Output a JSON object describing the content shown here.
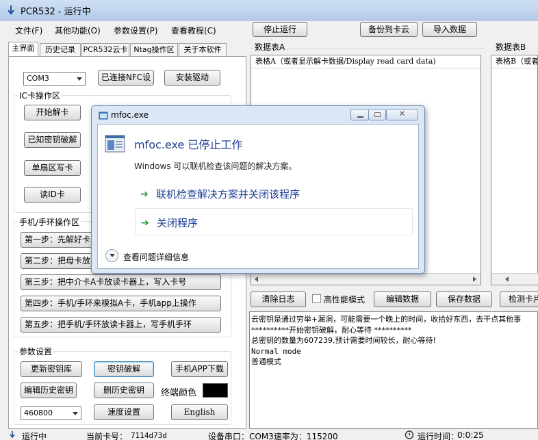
{
  "window": {
    "title": "PCR532 - 运行中"
  },
  "menu": {
    "file": "文件(F)",
    "other": "其他功能(O)",
    "params": "参数设置(P)",
    "tutorial": "查看教程(C)"
  },
  "toolbar": {
    "stop": "停止运行",
    "backup": "备份到卡云",
    "import": "导入数据"
  },
  "tabs": [
    "主界面",
    "历史记录",
    "PCR532云卡",
    "Ntag操作区",
    "关于本软件"
  ],
  "left": {
    "port": "COM3",
    "nfc_connected": "已连接NFC设",
    "install_driver": "安装驱动",
    "ic_group": "IC卡操作区",
    "start_crack": "开始解卡",
    "known_key": "已知密钥破解",
    "single_sector": "单扇区写卡",
    "read_id": "读ID卡",
    "phone_group": "手机/手环操作区",
    "steps": [
      "第一步：先解好卡",
      "第二步：把母卡放在",
      "第三步：把中介卡A卡放读卡器上，写入卡号",
      "第四步：手机/手环来模拟A卡，手机app上操作",
      "第五步：把手机/手环放读卡器上，写手机手环"
    ],
    "param_group": "参数设置",
    "update_keys": "更新密钥库",
    "key_crack": "密钥破解",
    "app_download": "手机APP下载",
    "edit_history": "编辑历史密钥",
    "delete_history": "删历史密钥",
    "terminal_color": "终端颜色",
    "terminal_color_value": "#000000",
    "baud": "460800",
    "speed": "速度设置",
    "english": "English"
  },
  "right": {
    "table_a_group": "数据表A",
    "table_a_header": "表格A（或者显示解卡数据/Display read card data)",
    "table_b_group": "数据表B",
    "table_b_header": "表格B（或者",
    "clear_log": "清除日志",
    "high_perf": "高性能模式",
    "edit_data": "编辑数据",
    "save_data": "保存数据",
    "detect_card": "检测卡片",
    "log": [
      "云密钥是通过穷举+漏洞，可能需要一个晚上的时间，收拾好东西，去干点其他事",
      "**********开始密钥破解，耐心等待 **********",
      "总密钥的数量为607239,预计需要时间较长，耐心等待!",
      "Normal mode",
      "普通模式"
    ]
  },
  "status": {
    "state": "运行中",
    "card_label": "当前卡号：",
    "card_no": "7114d73d",
    "port_info": "设备串口：COM3速率为：115200",
    "runtime_label": "运行时间：",
    "runtime": "0:0:25"
  },
  "dialog": {
    "title": "mfoc.exe",
    "heading": "mfoc.exe 已停止工作",
    "message": "Windows 可以联机检查该问题的解决方案。",
    "option1": "联机检查解决方案并关闭该程序",
    "option2": "关闭程序",
    "details": "查看问题详细信息"
  }
}
